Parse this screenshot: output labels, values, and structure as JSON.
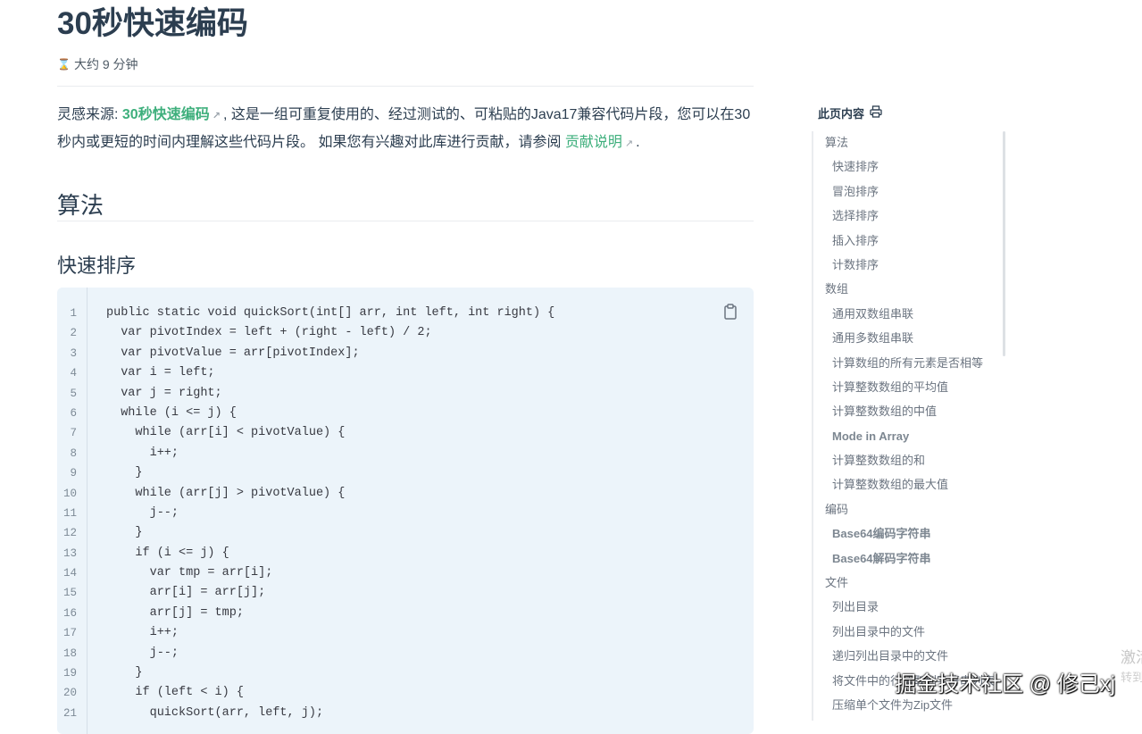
{
  "page": {
    "title": "30秒快速编码",
    "reading_time": "大约 9 分钟"
  },
  "intro": {
    "prefix": "灵感来源: ",
    "source_link": "30秒快速编码",
    "middle": ", 这是一组可重复使用的、经过测试的、可粘贴的Java17兼容代码片段，您可以在30秒内或更短的时间内理解这些代码片段。 如果您有兴趣对此库进行贡献，请参阅 ",
    "contrib_link": "贡献说明",
    "suffix": "."
  },
  "sections": {
    "h2": "算法",
    "h3": "快速排序"
  },
  "code": {
    "lines": [
      {
        "n": "1",
        "text": "public static void quickSort(int[] arr, int left, int right) {"
      },
      {
        "n": "2",
        "text": "  var pivotIndex = left + (right - left) / 2;"
      },
      {
        "n": "3",
        "text": "  var pivotValue = arr[pivotIndex];"
      },
      {
        "n": "4",
        "text": "  var i = left;"
      },
      {
        "n": "5",
        "text": "  var j = right;"
      },
      {
        "n": "6",
        "text": "  while (i <= j) {"
      },
      {
        "n": "7",
        "text": "    while (arr[i] < pivotValue) {"
      },
      {
        "n": "8",
        "text": "      i++;"
      },
      {
        "n": "9",
        "text": "    }"
      },
      {
        "n": "10",
        "text": "    while (arr[j] > pivotValue) {"
      },
      {
        "n": "11",
        "text": "      j--;"
      },
      {
        "n": "12",
        "text": "    }"
      },
      {
        "n": "13",
        "text": "    if (i <= j) {"
      },
      {
        "n": "14",
        "text": "      var tmp = arr[i];"
      },
      {
        "n": "15",
        "text": "      arr[i] = arr[j];"
      },
      {
        "n": "16",
        "text": "      arr[j] = tmp;"
      },
      {
        "n": "17",
        "text": "      i++;"
      },
      {
        "n": "18",
        "text": "      j--;"
      },
      {
        "n": "19",
        "text": "    }"
      },
      {
        "n": "20",
        "text": "    if (left < i) {"
      },
      {
        "n": "21",
        "text": "      quickSort(arr, left, j);"
      }
    ]
  },
  "toc": {
    "heading": "此页内容",
    "items": [
      {
        "label": "算法",
        "level": 1
      },
      {
        "label": "快速排序",
        "level": 2
      },
      {
        "label": "冒泡排序",
        "level": 2
      },
      {
        "label": "选择排序",
        "level": 2
      },
      {
        "label": "插入排序",
        "level": 2
      },
      {
        "label": "计数排序",
        "level": 2
      },
      {
        "label": "数组",
        "level": 1
      },
      {
        "label": "通用双数组串联",
        "level": 2
      },
      {
        "label": "通用多数组串联",
        "level": 2
      },
      {
        "label": "计算数组的所有元素是否相等",
        "level": 2
      },
      {
        "label": "计算整数数组的平均值",
        "level": 2
      },
      {
        "label": "计算整数数组的中值",
        "level": 2
      },
      {
        "label": "Mode in Array",
        "level": 2,
        "semi": true
      },
      {
        "label": "计算整数数组的和",
        "level": 2
      },
      {
        "label": "计算整数数组的最大值",
        "level": 2
      },
      {
        "label": "编码",
        "level": 1
      },
      {
        "label": "Base64编码字符串",
        "level": 2,
        "semi": true
      },
      {
        "label": "Base64解码字符串",
        "level": 2,
        "semi": true
      },
      {
        "label": "文件",
        "level": 1
      },
      {
        "label": "列出目录",
        "level": 2
      },
      {
        "label": "列出目录中的文件",
        "level": 2
      },
      {
        "label": "递归列出目录中的文件",
        "level": 2
      },
      {
        "label": "将文件中的行读取到字符串列表",
        "level": 2
      },
      {
        "label": "压缩单个文件为Zip文件",
        "level": 2
      }
    ]
  },
  "watermark": "掘金技术社区 @ 修己xj",
  "edge_text": {
    "line1": "激活",
    "line2": "转到"
  },
  "colors": {
    "accent": "#3eaf7c",
    "text": "#2c3e50",
    "code_bg": "#ecf4fa"
  },
  "icons": {
    "reading_time": "hourglass-icon",
    "print": "printer-icon",
    "copy": "clipboard-icon",
    "external": "external-link-icon"
  }
}
